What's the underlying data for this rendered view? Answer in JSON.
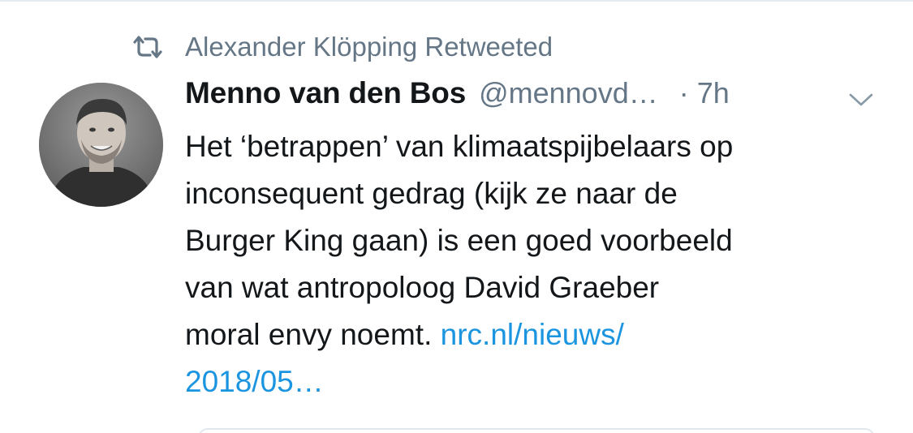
{
  "retweet": {
    "icon": "retweet-icon",
    "text": "Alexander Klöpping Retweeted"
  },
  "tweet": {
    "avatar_icon": "user-avatar",
    "display_name": "Menno van den Bos",
    "handle": "@mennovd…",
    "time": "· 7h",
    "menu_icon": "chevron-down-icon",
    "lines": [
      "Het ‘betrappen’ van klimaatspijbelaars op",
      "inconsequent gedrag (kijk ze naar de",
      "Burger King gaan) is een goed voorbeeld",
      "van wat antropoloog David Graeber"
    ],
    "last_line_text": "moral envy noemt.",
    "link_part1": "nrc.nl/nieuws/",
    "link_part2": "2018/05…"
  },
  "colors": {
    "text": "#14171a",
    "secondary": "#657786",
    "link": "#1b95e0"
  }
}
